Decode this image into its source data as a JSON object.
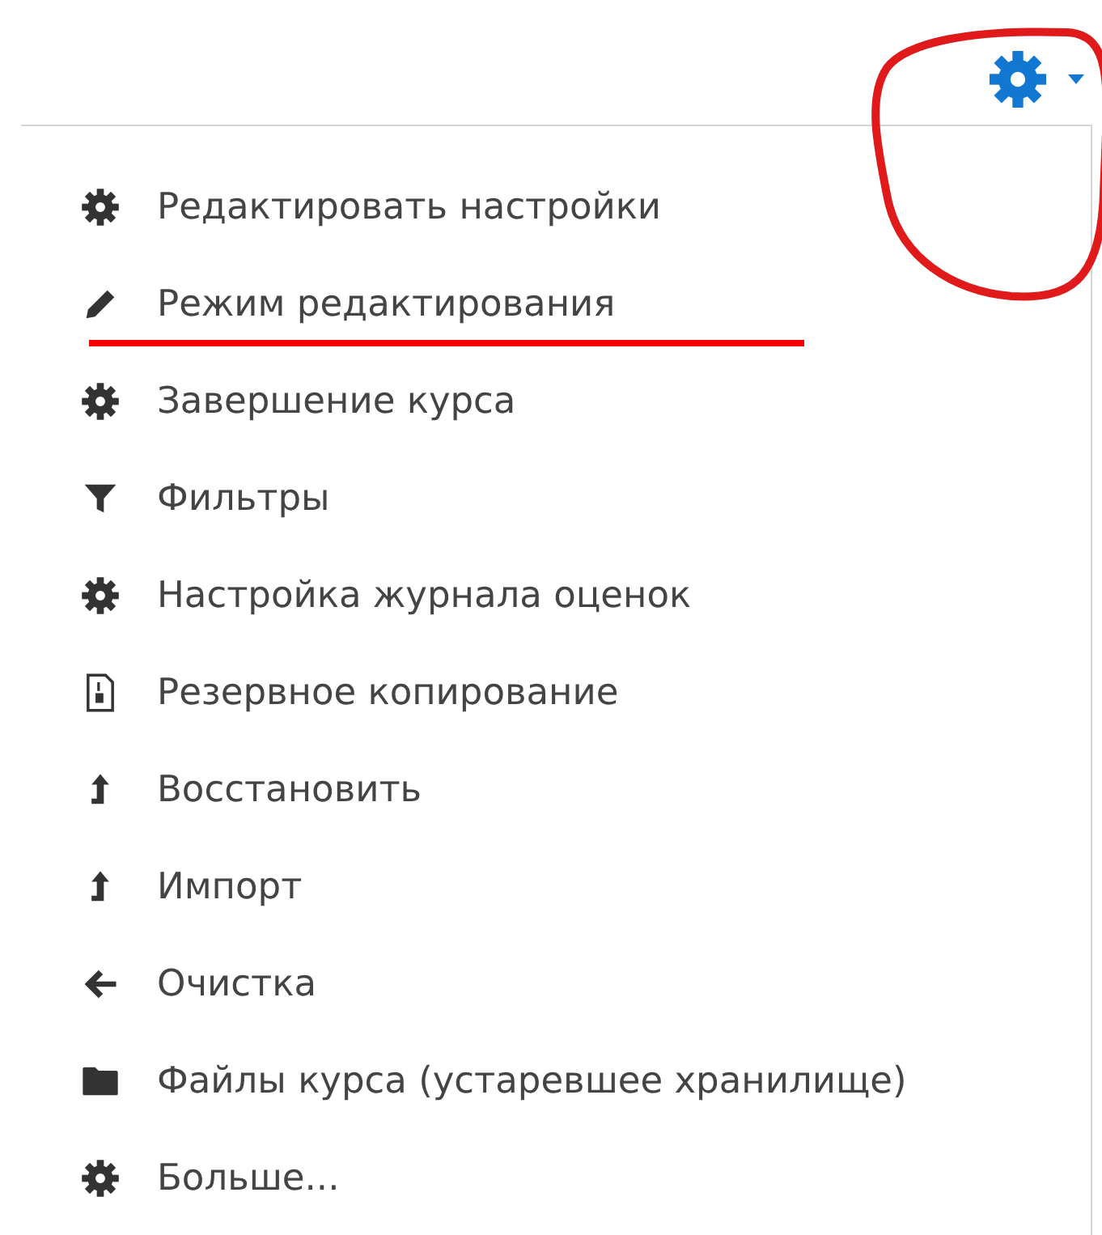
{
  "menu": {
    "items": [
      {
        "label": "Редактировать настройки",
        "kind": "gear"
      },
      {
        "label": "Режим редактирования",
        "kind": "pencil"
      },
      {
        "label": "Завершение курса",
        "kind": "gear"
      },
      {
        "label": "Фильтры",
        "kind": "filter"
      },
      {
        "label": "Настройка журнала оценок",
        "kind": "gear"
      },
      {
        "label": "Резервное копирование",
        "kind": "archive"
      },
      {
        "label": "Восстановить",
        "kind": "upload"
      },
      {
        "label": "Импорт",
        "kind": "upload"
      },
      {
        "label": "Очистка",
        "kind": "back"
      },
      {
        "label": "Файлы курса (устаревшее хранилище)",
        "kind": "folder"
      },
      {
        "label": "Больше...",
        "kind": "gear"
      }
    ]
  }
}
